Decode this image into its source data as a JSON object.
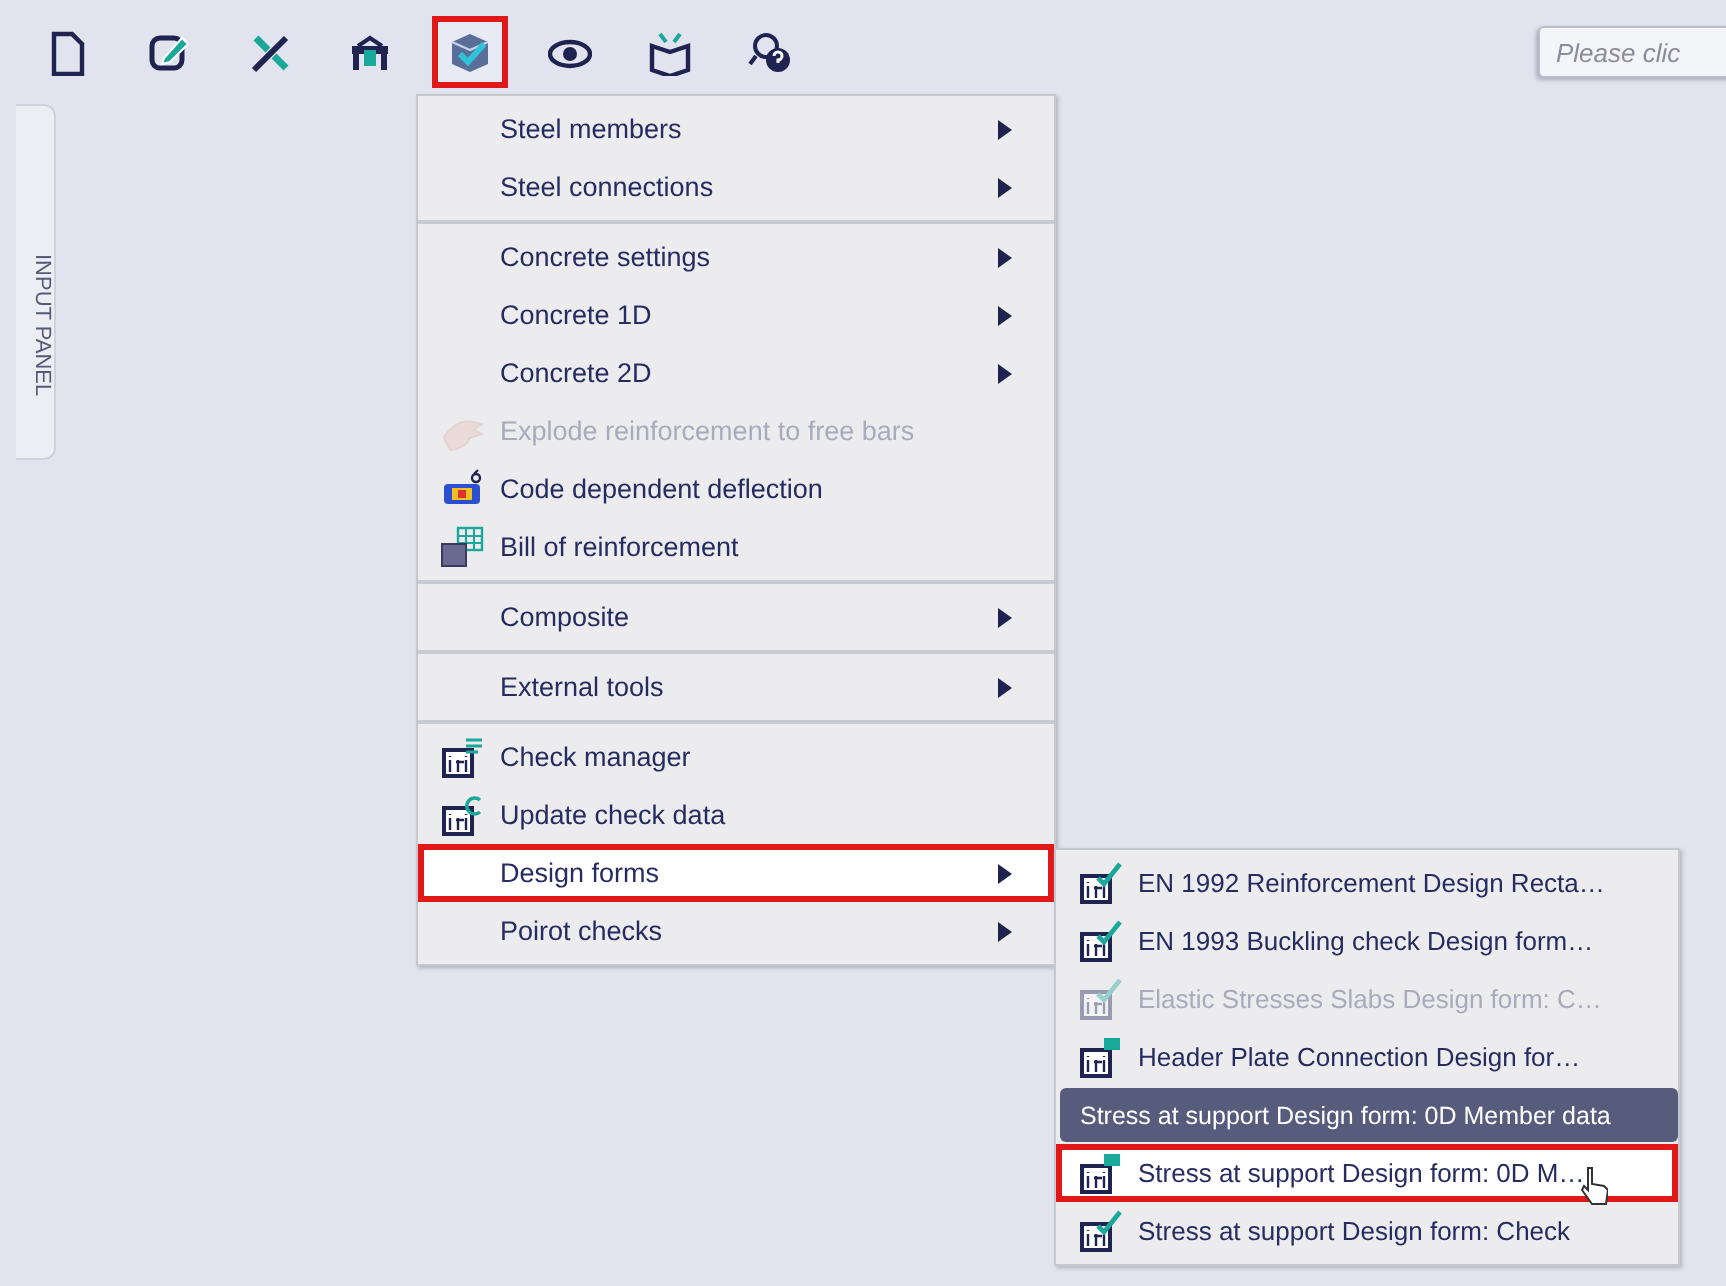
{
  "toolbar": [
    {
      "selected": false
    },
    {
      "selected": false
    },
    {
      "selected": false
    },
    {
      "selected": false
    },
    {
      "selected": true
    },
    {
      "selected": false
    },
    {
      "selected": false
    },
    {
      "selected": false
    }
  ],
  "hint_field": {
    "placeholder": "Please clic"
  },
  "input_panel": {
    "label": "INPUT PANEL"
  },
  "menu": {
    "sections": [
      [
        {
          "label": "Steel members",
          "kind": "submenu",
          "disabled": false,
          "selected": false
        },
        {
          "label": "Steel connections",
          "kind": "submenu",
          "disabled": false,
          "selected": false
        }
      ],
      [
        {
          "label": "Concrete settings",
          "kind": "submenu",
          "disabled": false,
          "selected": false
        },
        {
          "label": "Concrete 1D",
          "kind": "submenu",
          "disabled": false,
          "selected": false
        },
        {
          "label": "Concrete 2D",
          "kind": "submenu",
          "disabled": false,
          "selected": false
        },
        {
          "label": "Explode reinforcement to free bars",
          "kind": "command",
          "disabled": true,
          "selected": false
        },
        {
          "label": "Code dependent deflection",
          "kind": "command",
          "disabled": false,
          "selected": false
        },
        {
          "label": "Bill of reinforcement",
          "kind": "command",
          "disabled": false,
          "selected": false
        }
      ],
      [
        {
          "label": "Composite",
          "kind": "submenu",
          "disabled": false,
          "selected": false
        }
      ],
      [
        {
          "label": "External tools",
          "kind": "submenu",
          "disabled": false,
          "selected": false
        }
      ],
      [
        {
          "label": "Check manager",
          "kind": "command",
          "disabled": false,
          "selected": false
        },
        {
          "label": "Update check data",
          "kind": "command",
          "disabled": false,
          "selected": false
        },
        {
          "label": "Design forms",
          "kind": "submenu",
          "disabled": false,
          "selected": true
        },
        {
          "label": "Poirot checks",
          "kind": "submenu",
          "disabled": false,
          "selected": false
        }
      ]
    ]
  },
  "submenu": {
    "items": [
      {
        "label": "EN 1992 Reinforcement Design Recta…",
        "kind": "checked-form",
        "disabled": false,
        "selected": false
      },
      {
        "label": "EN 1993 Buckling check Design form…",
        "kind": "checked-form",
        "disabled": false,
        "selected": false
      },
      {
        "label": "Elastic Stresses Slabs Design form: C…",
        "kind": "checked-form",
        "disabled": true,
        "selected": false
      },
      {
        "label": "Header Plate Connection Design for…",
        "kind": "flagged-form",
        "disabled": false,
        "selected": false
      },
      {
        "label": "Stress at support Design form: 0D M…",
        "kind": "flagged-form",
        "disabled": false,
        "selected": true
      },
      {
        "label": "Stress at support Design form: Check",
        "kind": "checked-form",
        "disabled": false,
        "selected": false
      }
    ],
    "tooltip": "Stress at support Design form: 0D Member data"
  }
}
